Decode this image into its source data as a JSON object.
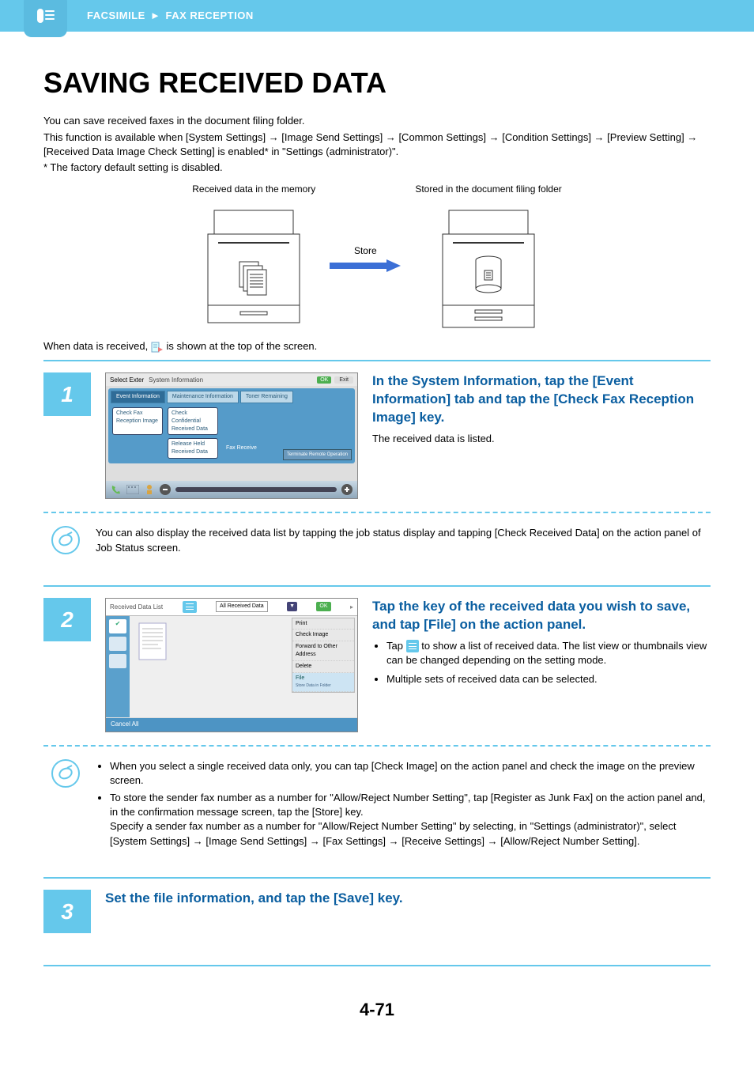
{
  "banner": {
    "section1": "FACSIMILE",
    "section2": "FAX RECEPTION"
  },
  "title": "SAVING RECEIVED DATA",
  "intro": {
    "p1": "You can save received faxes in the document filing folder.",
    "p2": "This function is available when [System Settings] → [Image Send Settings] → [Common Settings] → [Condition Settings] → [Preview Setting] → [Received Data Image Check Setting] is enabled* in \"Settings (administrator)\".",
    "p3": "* The factory default setting is disabled."
  },
  "diagram": {
    "cap_left": "Received data in the memory",
    "cap_right": "Stored in the document filing folder",
    "store": "Store"
  },
  "received_line_a": "When data is received, ",
  "received_line_b": " is shown at the top of the screen.",
  "step1": {
    "num": "1",
    "title": "In the System Information, tap the [Event Information] tab and tap the [Check Fax Reception Image] key.",
    "desc": "The received data is listed.",
    "ss": {
      "topleft": "Select Exter",
      "title": "System Information",
      "ok": "OK",
      "exit": "Exit",
      "tab1": "Event Information",
      "tab2": "Maintenance Information",
      "tab3": "Toner Remaining",
      "btn1": "Check Fax Reception Image",
      "btn2": "Check Confidential Received Data",
      "btn3": "Release Held Received Data",
      "status": "Fax Receive",
      "terminate": "Terminate Remote Operation"
    }
  },
  "note1": "You can also display the received data list by tapping the job status display and tapping [Check Received Data] on the action panel of Job Status screen.",
  "step2": {
    "num": "2",
    "title": "Tap the key of the received data you wish to save, and tap [File] on the action panel.",
    "bullet1a": "Tap ",
    "bullet1b": " to show a list of received data. The list view or thumbnails view can be changed depending on the setting mode.",
    "bullet2": "Multiple sets of received data can be selected.",
    "ss": {
      "header": "Received Data List",
      "dropdown": "All Received Data",
      "ok": "OK",
      "panel": {
        "print": "Print",
        "check": "Check Image",
        "forward": "Forward to Other Address",
        "delete": "Delete",
        "file": "File",
        "file_sub": "Store Data in Folder"
      },
      "cancel": "Cancel All"
    }
  },
  "note2": {
    "b1": "When you select a single received data only, you can tap [Check Image] on the action panel and check the image on the preview screen.",
    "b2a": "To store the sender fax number as a number for \"Allow/Reject Number Setting\", tap [Register as Junk Fax] on the action panel and, in the confirmation message screen, tap the [Store] key.",
    "b2b": "Specify a sender fax number as a number for \"Allow/Reject Number Setting\" by selecting, in \"Settings (administrator)\", select [System Settings] → [Image Send Settings] → [Fax Settings] → [Receive Settings] → [Allow/Reject Number Setting]."
  },
  "step3": {
    "num": "3",
    "title": "Set the file information, and tap the [Save] key."
  },
  "page_number": "4-71"
}
